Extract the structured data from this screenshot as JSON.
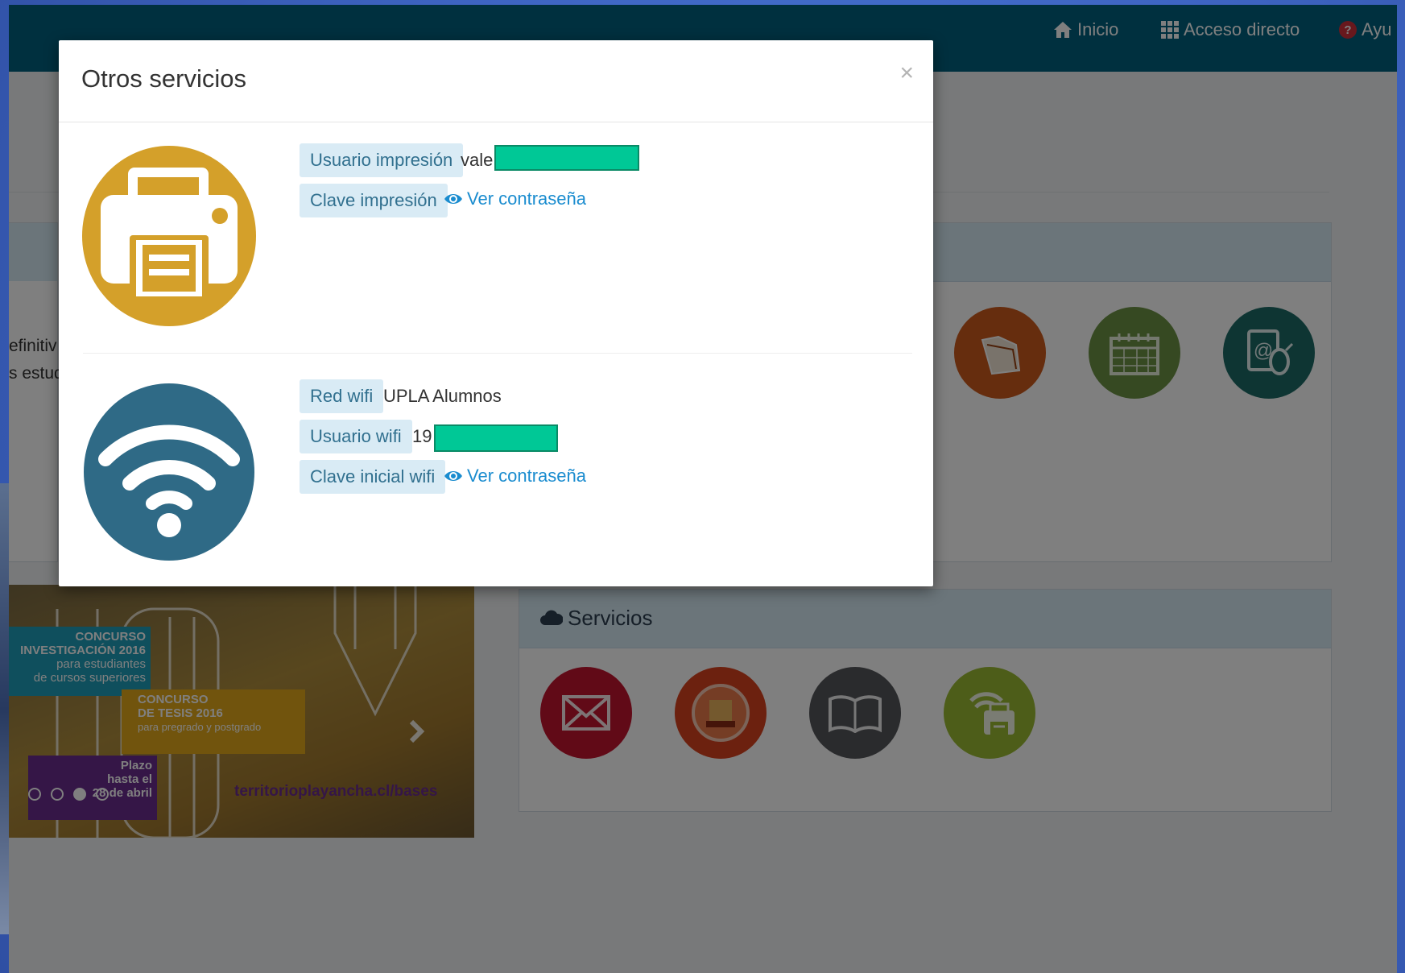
{
  "navbar": {
    "inicio": "Inicio",
    "acceso_directo": "Acceso directo",
    "ayuda": "Ayu"
  },
  "page": {
    "left_fragments": [
      "efinitiv",
      "s estud"
    ],
    "servicios_title": "Servicios",
    "app_icon_colors": [
      "#cc5a1d",
      "#6d9245",
      "#1d6b66"
    ],
    "service_icon_colors": [
      "#c3142f",
      "#d9431f",
      "#55565a",
      "#9aba32"
    ]
  },
  "banner": {
    "block1_title": "CONCURSO",
    "block1_line2": "INVESTIGACIÓN 2016",
    "block1_line3": "para estudiantes",
    "block1_line4": "de cursos superiores",
    "block2_title": "CONCURSO",
    "block2_line2": "DE TESIS 2016",
    "block2_line3": "para pregrado y postgrado",
    "block3_line1": "Plazo",
    "block3_line2": "hasta el",
    "block3_line3": "28 de abril",
    "url": "territorioplayancha.cl/bases"
  },
  "modal": {
    "title": "Otros servicios",
    "close": "×",
    "printing": {
      "user_label": "Usuario impresión",
      "user_value": "vale",
      "pass_label": "Clave impresión",
      "pass_link": "Ver contraseña",
      "icon_color": "#d4a02a"
    },
    "wifi": {
      "network_label": "Red wifi",
      "network_value": "UPLA Alumnos",
      "user_label": "Usuario wifi",
      "user_value": "19",
      "pass_label": "Clave inicial wifi",
      "pass_link": "Ver contraseña",
      "icon_color": "#2f6a86"
    }
  }
}
